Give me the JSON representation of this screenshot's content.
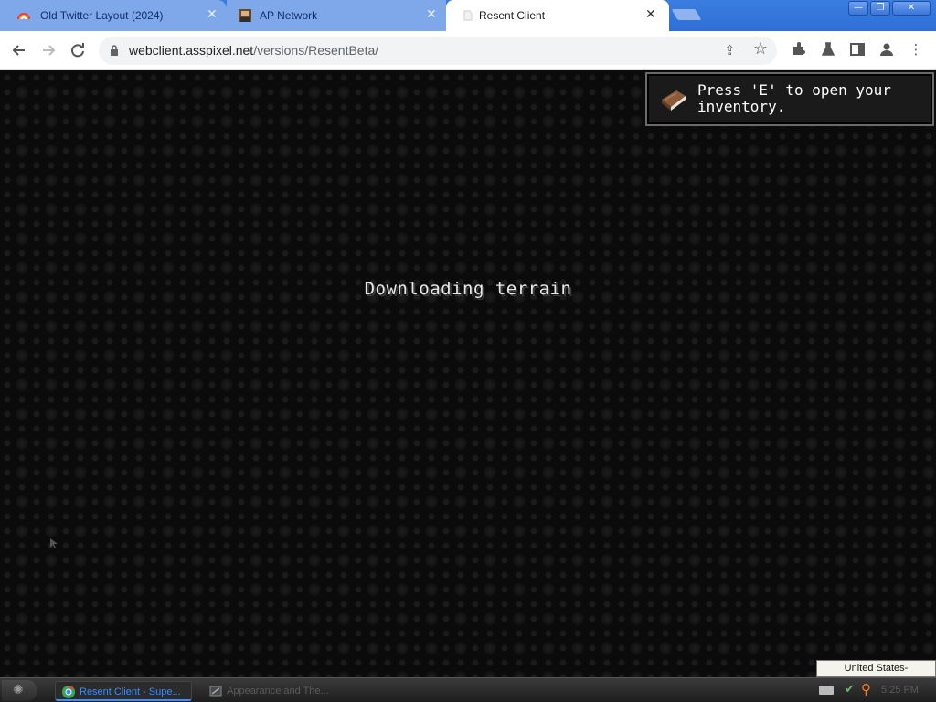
{
  "browser": {
    "tabs": [
      {
        "title": "Old Twitter Layout (2024)",
        "icon": "rainbow-favicon-icon",
        "active": false
      },
      {
        "title": "AP Network",
        "icon": "ap-network-favicon-icon",
        "active": false
      },
      {
        "title": "Resent Client",
        "icon": "blank-favicon-icon",
        "active": true
      }
    ],
    "close_glyph": "✕",
    "window_buttons": {
      "minimize": "—",
      "maximize": "❐",
      "close": "✕"
    },
    "url_host": "webclient.asspixel.net",
    "url_path": "/versions/ResentBeta/"
  },
  "game": {
    "loading_text": "Downloading terrain",
    "toast": {
      "line1": "Press 'E' to open your",
      "line2": "inventory.",
      "icon": "book-icon"
    }
  },
  "taskbar": {
    "language": "United States-International",
    "tasks": [
      {
        "label": "Resent Client - Supe...",
        "icon": "chrome-icon",
        "active": true
      },
      {
        "label": "Appearance and The...",
        "icon": "window-icon",
        "active": false
      }
    ],
    "clock": "5:25 PM"
  },
  "colors": {
    "titlebar": "#2f6fd6",
    "game_bg": "#0b0b0b",
    "task_active": "#3b8cff"
  }
}
